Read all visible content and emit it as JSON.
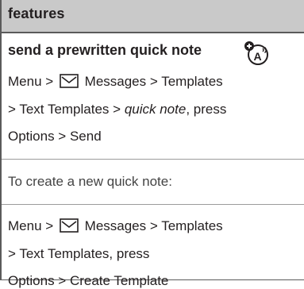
{
  "header": {
    "title": "features"
  },
  "feature": {
    "title": "send a prewritten quick note",
    "icon": "speaker-phone-icon"
  },
  "send_path": {
    "menu": "Menu >",
    "messages": "Messages > Templates",
    "text_templates": "> Text Templates >",
    "quick_note": "quick note",
    "press": ", press",
    "options_send": "Options > Send"
  },
  "create_intro": "To create a new quick note:",
  "create_path": {
    "menu": "Menu >",
    "messages": "Messages > Templates",
    "text_templates": "> Text Templates, press",
    "options_create": "Options > Create Template"
  },
  "icons": {
    "messages": "envelope-icon"
  }
}
